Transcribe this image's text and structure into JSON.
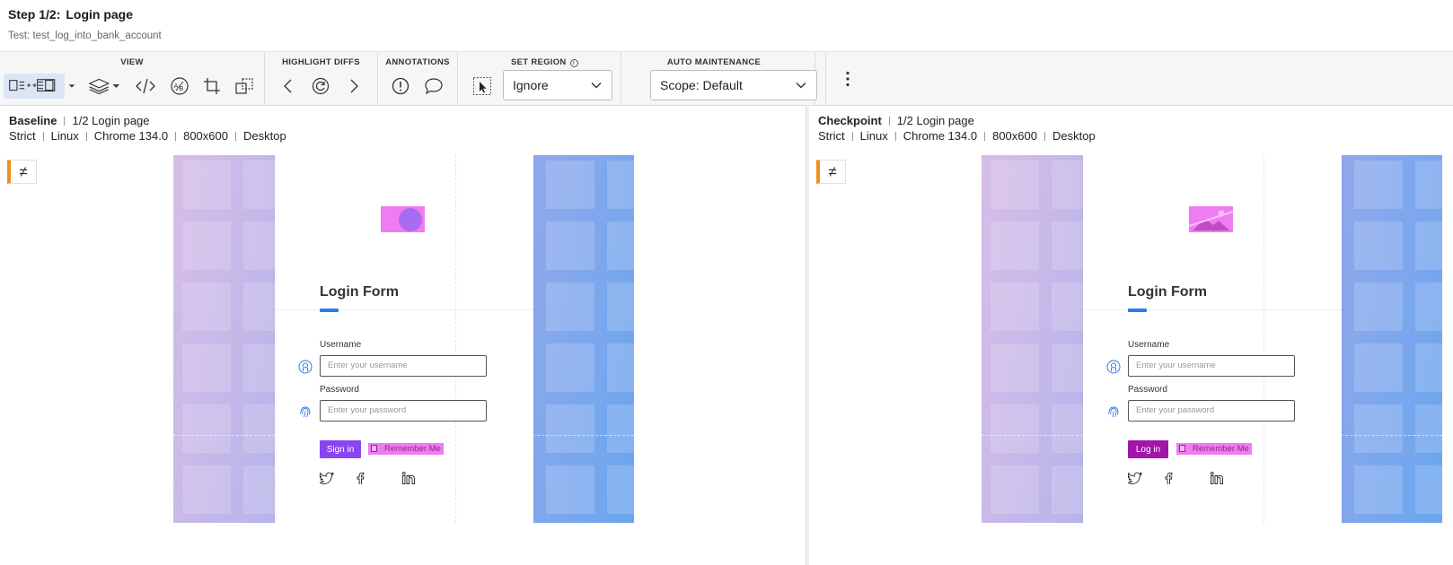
{
  "header": {
    "step": "Step 1/2:",
    "step_name": "Login page",
    "test_name": "Test: test_log_into_bank_account"
  },
  "toolbar": {
    "view_label": "VIEW",
    "highlight_label": "HIGHLIGHT DIFFS",
    "annotations_label": "ANNOTATIONS",
    "set_region_label": "SET REGION",
    "set_region_value": "Ignore",
    "auto_maintenance_label": "AUTO MAINTENANCE",
    "scope_value": "Scope: Default",
    "icons": [
      "side-by-side-icon",
      "layers-icon",
      "code-icon",
      "ab-compare-icon",
      "crop-icon",
      "overlap-icon",
      "previous-diff-icon",
      "refresh-diff-icon",
      "next-diff-icon",
      "issue-icon",
      "comment-icon",
      "select-region-icon",
      "more-options-icon"
    ]
  },
  "baseline": {
    "title": "Baseline",
    "step": "1/2 Login page",
    "meta": [
      "Strict",
      "Linux",
      "Chrome 134.0",
      "800x600",
      "Desktop"
    ],
    "badge": "≠",
    "shot": {
      "form_title": "Login Form",
      "username_label": "Username",
      "username_placeholder": "Enter your username",
      "password_label": "Password",
      "password_placeholder": "Enter your password",
      "button_label": "Sign in",
      "button_color": "#8a45f0",
      "remember": "Remember Me"
    }
  },
  "checkpoint": {
    "title": "Checkpoint",
    "step": "1/2 Login page",
    "meta": [
      "Strict",
      "Linux",
      "Chrome 134.0",
      "800x600",
      "Desktop"
    ],
    "badge": "≠",
    "shot": {
      "form_title": "Login Form",
      "username_label": "Username",
      "username_placeholder": "Enter your username",
      "password_label": "Password",
      "password_placeholder": "Enter your password",
      "button_label": "Log in",
      "button_color": "#a116a8",
      "remember": "Remember Me"
    }
  },
  "colors": {
    "accent": "#2e7be6",
    "diff_highlight": "#f07af0",
    "badge_stripe": "#f0901a"
  }
}
